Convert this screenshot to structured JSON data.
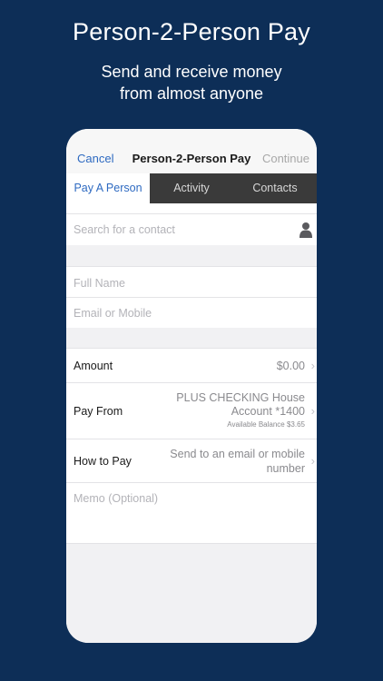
{
  "promo": {
    "title": "Person-2-Person Pay",
    "subtitle_line1": "Send and receive money",
    "subtitle_line2": "from almost anyone"
  },
  "navbar": {
    "cancel": "Cancel",
    "title": "Person-2-Person Pay",
    "continue": "Continue"
  },
  "tabs": [
    {
      "label": "Pay A Person",
      "active": true
    },
    {
      "label": "Activity",
      "active": false
    },
    {
      "label": "Contacts",
      "active": false
    }
  ],
  "search": {
    "placeholder": "Search for a contact",
    "icon": "person-icon"
  },
  "recipient": {
    "full_name_placeholder": "Full Name",
    "email_placeholder": "Email or Mobile"
  },
  "payment": {
    "amount_label": "Amount",
    "amount_value": "$0.00",
    "pay_from_label": "Pay From",
    "pay_from_line1": "PLUS CHECKING House",
    "pay_from_line2": "Account *1400",
    "available_balance": "Available Balance $3.65",
    "how_to_pay_label": "How to Pay",
    "how_to_pay_line1": "Send to an email or mobile",
    "how_to_pay_line2": "number",
    "memo_placeholder": "Memo (Optional)"
  },
  "colors": {
    "background": "#0d2e57",
    "accent": "#2e6ac1",
    "tab_bar": "#3a3a3a"
  }
}
